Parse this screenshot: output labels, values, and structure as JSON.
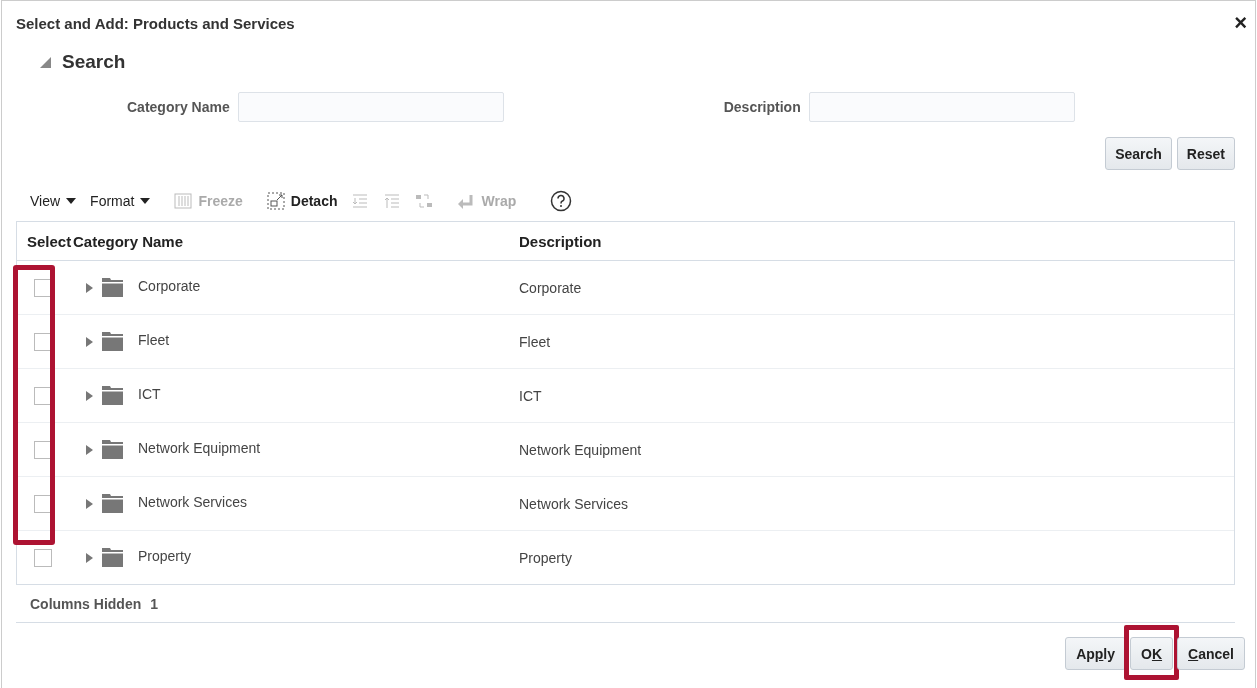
{
  "dialog": {
    "title": "Select and Add: Products and Services",
    "close": "×"
  },
  "search": {
    "heading": "Search",
    "expanded": true,
    "fields": [
      {
        "label": "Category Name"
      },
      {
        "label": "Description"
      }
    ],
    "buttons": [
      "Search",
      "Reset"
    ]
  },
  "toolbar": [
    {
      "kind": "menu",
      "label": "View",
      "disabled": false
    },
    {
      "kind": "menu",
      "label": "Format",
      "disabled": false
    },
    {
      "kind": "freeze",
      "label": "Freeze",
      "disabled": true
    },
    {
      "kind": "detach",
      "label": "Detach",
      "disabled": false
    },
    {
      "kind": "indent",
      "disabled": true
    },
    {
      "kind": "outdent",
      "disabled": true
    },
    {
      "kind": "move",
      "disabled": true
    },
    {
      "kind": "wrap",
      "label": "Wrap",
      "disabled": true
    },
    {
      "kind": "help",
      "disabled": false
    }
  ],
  "table": {
    "columns": [
      "Select",
      "Category Name",
      "Description"
    ],
    "select_column_highlighted": true,
    "rows": [
      {
        "name": "Corporate",
        "description": "Corporate",
        "checked": false,
        "expanded": false
      },
      {
        "name": "Fleet",
        "description": "Fleet",
        "checked": false,
        "expanded": false
      },
      {
        "name": "ICT",
        "description": "ICT",
        "checked": false,
        "expanded": false
      },
      {
        "name": "Network Equipment",
        "description": "Network Equipment",
        "checked": false,
        "expanded": false
      },
      {
        "name": "Network Services",
        "description": "Network Services",
        "checked": false,
        "expanded": false
      },
      {
        "name": "Property",
        "description": "Property",
        "checked": false,
        "expanded": false
      }
    ]
  },
  "columns_hidden": {
    "label": "Columns Hidden",
    "count": "1"
  },
  "footer_buttons": [
    {
      "before": "Ap",
      "key": "p",
      "after": "ly",
      "highlighted": false
    },
    {
      "before": "O",
      "key": "K",
      "highlighted": true
    },
    {
      "key": "C",
      "after": "ancel",
      "highlighted": false
    }
  ]
}
